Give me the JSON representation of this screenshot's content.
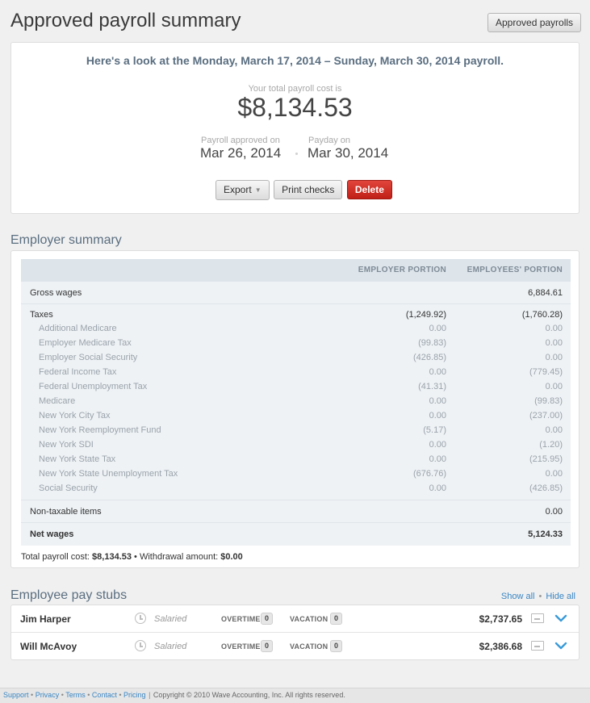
{
  "header": {
    "title": "Approved payroll summary",
    "approved_payrolls_button": "Approved payrolls"
  },
  "summary": {
    "headline": "Here's a look at the Monday, March 17, 2014 – Sunday, March 30, 2014 payroll.",
    "cost_label": "Your total payroll cost is",
    "cost_value": "$8,134.53",
    "approved_label": "Payroll approved on",
    "approved_date": "Mar 26, 2014",
    "payday_label": "Payday on",
    "payday_date": "Mar 30, 2014",
    "export_button": "Export",
    "print_button": "Print checks",
    "delete_button": "Delete"
  },
  "employer_summary": {
    "title": "Employer summary",
    "col_employer": "EMPLOYER PORTION",
    "col_employees": "EMPLOYEES' PORTION",
    "gross_wages": {
      "label": "Gross wages",
      "employer": "",
      "employees": "6,884.61"
    },
    "taxes": {
      "label": "Taxes",
      "employer": "(1,249.92)",
      "employees": "(1,760.28)"
    },
    "tax_rows": [
      {
        "label": "Additional Medicare",
        "employer": "0.00",
        "employees": "0.00"
      },
      {
        "label": "Employer Medicare Tax",
        "employer": "(99.83)",
        "employees": "0.00"
      },
      {
        "label": "Employer Social Security",
        "employer": "(426.85)",
        "employees": "0.00"
      },
      {
        "label": "Federal Income Tax",
        "employer": "0.00",
        "employees": "(779.45)"
      },
      {
        "label": "Federal Unemployment Tax",
        "employer": "(41.31)",
        "employees": "0.00"
      },
      {
        "label": "Medicare",
        "employer": "0.00",
        "employees": "(99.83)"
      },
      {
        "label": "New York City Tax",
        "employer": "0.00",
        "employees": "(237.00)"
      },
      {
        "label": "New York Reemployment Fund",
        "employer": "(5.17)",
        "employees": "0.00"
      },
      {
        "label": "New York SDI",
        "employer": "0.00",
        "employees": "(1.20)"
      },
      {
        "label": "New York State Tax",
        "employer": "0.00",
        "employees": "(215.95)"
      },
      {
        "label": "New York State Unemployment Tax",
        "employer": "(676.76)",
        "employees": "0.00"
      },
      {
        "label": "Social Security",
        "employer": "0.00",
        "employees": "(426.85)"
      }
    ],
    "non_taxable": {
      "label": "Non-taxable items",
      "employer": "",
      "employees": "0.00"
    },
    "net_wages": {
      "label": "Net wages",
      "employer": "",
      "employees": "5,124.33"
    },
    "total_cost_label": "Total payroll cost:",
    "total_cost_value": "$8,134.53",
    "withdrawal_label": "Withdrawal amount:",
    "withdrawal_value": "$0.00"
  },
  "pay_stubs": {
    "title": "Employee pay stubs",
    "show_all": "Show all",
    "hide_all": "Hide all",
    "overtime_label": "OVERTIME",
    "vacation_label": "VACATION",
    "employees": [
      {
        "name": "Jim Harper",
        "type": "Salaried",
        "overtime": "0",
        "vacation": "0",
        "amount": "$2,737.65"
      },
      {
        "name": "Will McAvoy",
        "type": "Salaried",
        "overtime": "0",
        "vacation": "0",
        "amount": "$2,386.68"
      }
    ]
  },
  "footer": {
    "links": [
      "Support",
      "Privacy",
      "Terms",
      "Contact",
      "Pricing"
    ],
    "copyright": "Copyright © 2010 Wave Accounting, Inc. All rights reserved."
  },
  "colors": {
    "accent": "#3a86c4",
    "delete": "#c9251c",
    "heading": "#5a6e80"
  }
}
